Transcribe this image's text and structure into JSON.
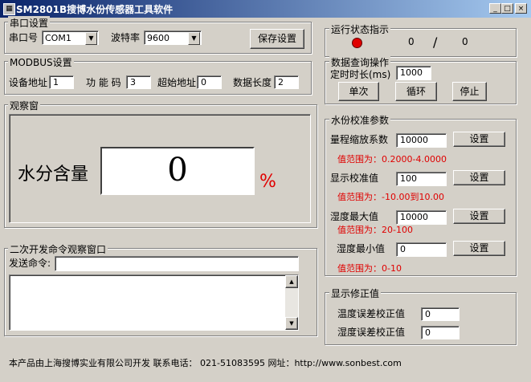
{
  "window": {
    "title": "SM2801B搜博水份传感器工具软件",
    "minimize_glyph": "_",
    "maximize_glyph": "□",
    "close_glyph": "×"
  },
  "serial": {
    "group_title": "串口设置",
    "port_label": "串口号",
    "port_value": "COM1",
    "baud_label": "波特率",
    "baud_value": "9600",
    "save_label": "保存设置"
  },
  "modbus": {
    "group_title": "MODBUS设置",
    "device_addr_label": "设备地址",
    "device_addr_value": "1",
    "function_code_label": "功 能 码",
    "function_code_value": "3",
    "start_addr_label": "超始地址",
    "start_addr_value": "0",
    "data_length_label": "数据长度",
    "data_length_value": "2"
  },
  "observe": {
    "group_title": "观察窗",
    "moisture_label": "水分含量",
    "moisture_value": "0",
    "unit": "%"
  },
  "dev": {
    "group_title": "二次开发命令观察窗口",
    "send_label": "发送命令:",
    "send_value": ""
  },
  "status": {
    "group_title": "运行状态指示",
    "indicator_color": "#e00000",
    "count_a": "0",
    "separator": "/",
    "count_b": "0"
  },
  "query": {
    "group_title": "数据查询操作",
    "interval_label": "定时时长(ms)",
    "interval_value": "1000",
    "single_label": "单次",
    "loop_label": "循环",
    "stop_label": "停止"
  },
  "calib": {
    "group_title": "水份校准参数",
    "set_label": "设置",
    "rows": [
      {
        "label": "量程缩放系数",
        "value": "10000",
        "hint": "值范围为：0.2000-4.0000"
      },
      {
        "label": "显示校准值",
        "value": "100",
        "hint": "值范围为：-10.00到10.00"
      },
      {
        "label": "湿度最大值",
        "value": "10000",
        "hint": "值范围为：20-100"
      },
      {
        "label": "湿度最小值",
        "value": "0",
        "hint": "值范围为：0-10"
      }
    ]
  },
  "correction": {
    "group_title": "显示修正值",
    "temp_label": "温度误差校正值",
    "temp_value": "0",
    "hum_label": "湿度误差校正值",
    "hum_value": "0"
  },
  "footer": {
    "text": "本产品由上海搜博实业有限公司开发 联系电话： 021-51083595 网址：http://www.sonbest.com"
  }
}
